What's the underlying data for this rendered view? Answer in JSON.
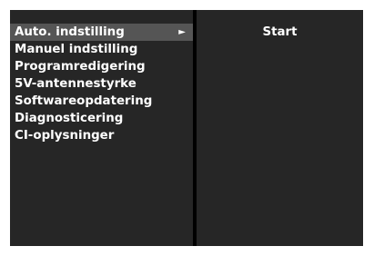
{
  "menu": {
    "items": [
      {
        "label": "Auto. indstilling",
        "selected": true
      },
      {
        "label": "Manuel indstilling"
      },
      {
        "label": "Programredigering"
      },
      {
        "label": "5V-antennestyrke"
      },
      {
        "label": "Softwareopdatering"
      },
      {
        "label": "Diagnosticering"
      },
      {
        "label": "CI-oplysninger"
      }
    ],
    "arrow_glyph": "►",
    "arrow_icon": "triangle-right-icon"
  },
  "submenu": {
    "start_label": "Start"
  },
  "colors": {
    "panel_bg": "#262626",
    "highlight_bg": "#555555",
    "divider": "#000000",
    "text": "#ffffff"
  }
}
